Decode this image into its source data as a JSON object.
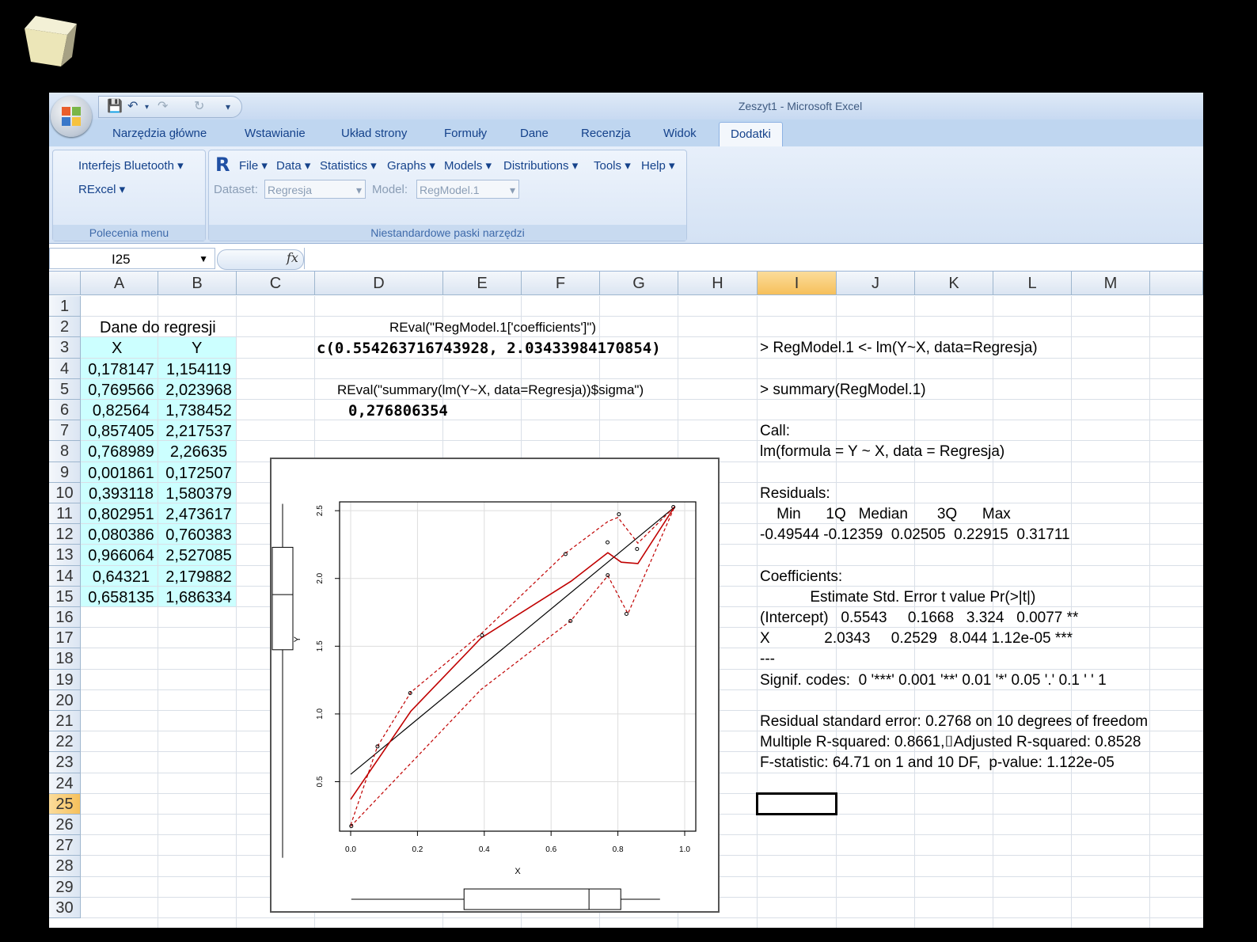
{
  "window": {
    "title": "Zeszyt1 - Microsoft Excel"
  },
  "tabs": [
    "Narzędzia główne",
    "Wstawianie",
    "Układ strony",
    "Formuły",
    "Dane",
    "Recenzja",
    "Widok",
    "Dodatki"
  ],
  "active_tab": "Dodatki",
  "ribbon": {
    "group1": {
      "items": [
        "Interfejs Bluetooth",
        "RExcel"
      ],
      "label": "Polecenia menu"
    },
    "group2": {
      "menus": [
        "File",
        "Data",
        "Statistics",
        "Graphs",
        "Models",
        "Distributions",
        "Tools",
        "Help"
      ],
      "dataset_label": "Dataset:",
      "dataset_value": "Regresja",
      "model_label": "Model:",
      "model_value": "RegModel.1",
      "label": "Niestandardowe paski narzędzi"
    }
  },
  "formula_bar": {
    "name_box": "I25",
    "formula": ""
  },
  "columns": [
    "A",
    "B",
    "C",
    "D",
    "E",
    "F",
    "G",
    "H",
    "I",
    "J",
    "K",
    "L",
    "M"
  ],
  "selected_column": "I",
  "selected_row": 25,
  "rows": [
    1,
    2,
    3,
    4,
    5,
    6,
    7,
    8,
    9,
    10,
    11,
    12,
    13,
    14,
    15,
    16,
    17,
    18,
    19,
    20,
    21,
    22,
    23,
    24,
    25,
    26,
    27,
    28,
    29,
    30
  ],
  "sheet": {
    "table_title": "Dane do regresji",
    "col_x": "X",
    "col_y": "Y",
    "x_values": [
      "0,178147",
      "0,769566",
      "0,82564",
      "0,857405",
      "0,768989",
      "0,001861",
      "0,393118",
      "0,802951",
      "0,080386",
      "0,966064",
      "0,64321",
      "0,658135"
    ],
    "y_values": [
      "1,154119",
      "2,023968",
      "1,738452",
      "2,217537",
      "2,26635",
      "0,172507",
      "1,580379",
      "2,473617",
      "0,760383",
      "2,527085",
      "2,179882",
      "1,686334"
    ],
    "d2": "REval(\"RegModel.1['coefficients']\")",
    "d3": "c(0.554263716743928, 2.03433984170854)",
    "d5": "REval(\"summary(lm(Y~X, data=Regresja))$sigma\")",
    "d6": "0,276806354",
    "i_col": {
      "r3": "> RegModel.1 <- lm(Y~X, data=Regresja)",
      "r5": "> summary(RegModel.1)",
      "r7": "Call:",
      "r8": "lm(formula = Y ~ X, data = Regresja)",
      "r10": "Residuals:",
      "r11": "    Min      1Q   Median       3Q      Max",
      "r12": "-0.49544 -0.12359  0.02505  0.22915  0.31711",
      "r14": "Coefficients:",
      "r15": "            Estimate Std. Error t value Pr(>|t|)",
      "r16": "(Intercept)   0.5543     0.1668   3.324   0.0077 **",
      "r17": "X             2.0343     0.2529   8.044 1.12e-05 ***",
      "r18": "---",
      "r19": "Signif. codes:  0 '***' 0.001 '**' 0.01 '*' 0.05 '.' 0.1 ' ' 1",
      "r21": "Residual standard error: 0.2768 on 10 degrees of freedom",
      "r22": "Multiple R-squared: 0.8661,⌷Adjusted R-squared: 0.8528",
      "r23": "F-statistic: 64.71 on 1 and 10 DF,  p-value: 1.122e-05"
    }
  },
  "chart_data": {
    "type": "scatter",
    "xlabel": "X",
    "ylabel": "Y",
    "xlim": [
      0.0,
      1.0
    ],
    "ylim": [
      0.0,
      2.6
    ],
    "x_ticks": [
      "0.0",
      "0.2",
      "0.4",
      "0.6",
      "0.8",
      "1.0"
    ],
    "y_ticks": [
      "0.5",
      "1.0",
      "1.5",
      "2.0",
      "2.5"
    ],
    "points": [
      {
        "x": 0.178147,
        "y": 1.154119
      },
      {
        "x": 0.769566,
        "y": 2.023968
      },
      {
        "x": 0.82564,
        "y": 1.738452
      },
      {
        "x": 0.857405,
        "y": 2.217537
      },
      {
        "x": 0.768989,
        "y": 2.26635
      },
      {
        "x": 0.001861,
        "y": 0.172507
      },
      {
        "x": 0.393118,
        "y": 1.580379
      },
      {
        "x": 0.802951,
        "y": 2.473617
      },
      {
        "x": 0.080386,
        "y": 0.760383
      },
      {
        "x": 0.966064,
        "y": 2.527085
      },
      {
        "x": 0.64321,
        "y": 2.179882
      },
      {
        "x": 0.658135,
        "y": 1.686334
      }
    ],
    "regression_line": {
      "intercept": 0.5543,
      "slope": 2.0343
    },
    "smooth_line": [
      [
        0.0,
        0.37
      ],
      [
        0.18,
        1.02
      ],
      [
        0.39,
        1.56
      ],
      [
        0.66,
        1.98
      ],
      [
        0.77,
        2.19
      ],
      [
        0.81,
        2.12
      ],
      [
        0.86,
        2.11
      ],
      [
        0.97,
        2.53
      ]
    ],
    "smooth_upper": [
      [
        0.0,
        0.18
      ],
      [
        0.08,
        0.76
      ],
      [
        0.18,
        1.16
      ],
      [
        0.39,
        1.59
      ],
      [
        0.64,
        2.18
      ],
      [
        0.77,
        2.42
      ],
      [
        0.8,
        2.45
      ],
      [
        0.86,
        2.26
      ],
      [
        0.97,
        2.53
      ]
    ],
    "smooth_lower": [
      [
        0.0,
        0.17
      ],
      [
        0.39,
        1.18
      ],
      [
        0.66,
        1.69
      ],
      [
        0.77,
        2.02
      ],
      [
        0.83,
        1.74
      ],
      [
        0.97,
        2.53
      ]
    ],
    "colors": {
      "points": "#000000",
      "regression": "#000000",
      "smooth": "#c00000"
    }
  }
}
